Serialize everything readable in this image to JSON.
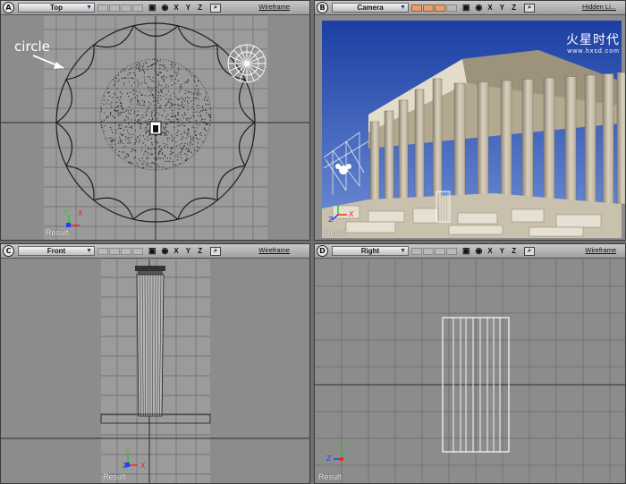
{
  "annotation": "circle",
  "result_label": "Result",
  "logo": {
    "text": "火星时代",
    "url": "www.hxsd.com"
  },
  "axis_labels": {
    "x": "X",
    "y": "Y",
    "z": "Z"
  },
  "colors": {
    "axis_x": "#ff2020",
    "axis_y": "#20d020",
    "axis_z": "#2040ff",
    "grid": "#5e5e5e",
    "header_slot_active": "#e79e6c"
  },
  "viewports": [
    {
      "letter": "A",
      "view": "Top",
      "mode": "Wireframe",
      "xyz": "X Y Z"
    },
    {
      "letter": "B",
      "view": "Camera",
      "mode": "Hidden Li...",
      "xyz": "X Y Z"
    },
    {
      "letter": "C",
      "view": "Front",
      "mode": "Wireframe",
      "xyz": "X Y Z"
    },
    {
      "letter": "D",
      "view": "Right",
      "mode": "Wireframe",
      "xyz": "X Y Z"
    }
  ]
}
